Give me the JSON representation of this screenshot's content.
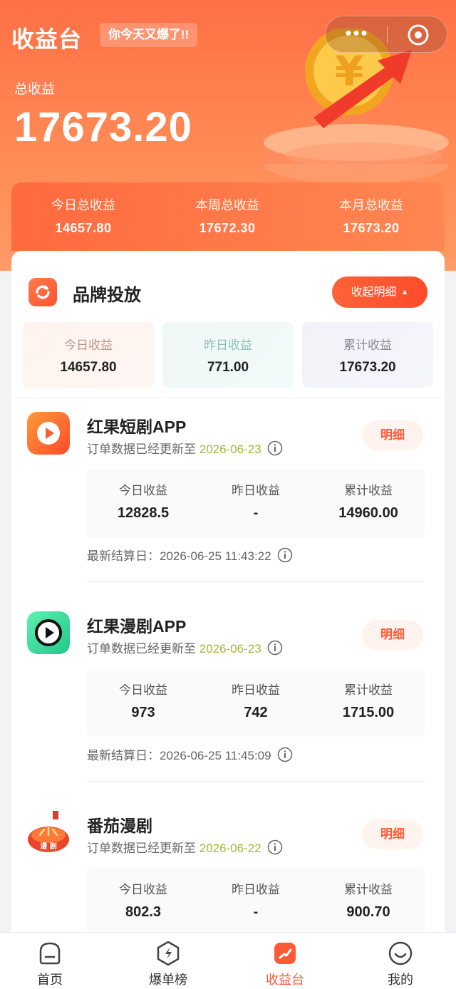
{
  "header": {
    "brand": "收益台",
    "tagline": "你今天又爆了!!",
    "total_label": "总收益",
    "total_value": "17673.20",
    "capsule": {
      "more_icon": "more-dots-icon",
      "close_icon": "target-circle-icon"
    }
  },
  "summary": [
    {
      "label": "今日总收益",
      "value": "14657.80"
    },
    {
      "label": "本周总收益",
      "value": "17672.30"
    },
    {
      "label": "本月总收益",
      "value": "17673.20"
    }
  ],
  "section": {
    "title": "品牌投放",
    "collapse_label": "收起明细",
    "stats": [
      {
        "label": "今日收益",
        "value": "14657.80",
        "label_color": "#c0958a"
      },
      {
        "label": "昨日收益",
        "value": "771.00",
        "label_color": "#8fbfb9"
      },
      {
        "label": "累计收益",
        "value": "17673.20",
        "label_color": "#8c8c99"
      }
    ]
  },
  "apps": [
    {
      "name": "红果短剧APP",
      "update_prefix": "订单数据已经更新至",
      "update_date": "2026-06-23",
      "detail_label": "明细",
      "stats": [
        {
          "label": "今日收益",
          "value": "12828.5"
        },
        {
          "label": "昨日收益",
          "value": "-"
        },
        {
          "label": "累计收益",
          "value": "14960.00"
        }
      ],
      "settle": "最新结算日：2026-06-25 11:43:22"
    },
    {
      "name": "红果漫剧APP",
      "update_prefix": "订单数据已经更新至",
      "update_date": "2026-06-23",
      "detail_label": "明细",
      "stats": [
        {
          "label": "今日收益",
          "value": "973"
        },
        {
          "label": "昨日收益",
          "value": "742"
        },
        {
          "label": "累计收益",
          "value": "1715.00"
        }
      ],
      "settle": "最新结算日：2026-06-25 11:45:09"
    },
    {
      "name": "番茄漫剧",
      "update_prefix": "订单数据已经更新至",
      "update_date": "2026-06-22",
      "detail_label": "明细",
      "stats": [
        {
          "label": "今日收益",
          "value": "802.3"
        },
        {
          "label": "昨日收益",
          "value": "-"
        },
        {
          "label": "累计收益",
          "value": "900.70"
        }
      ],
      "settle": ""
    }
  ],
  "tabs": [
    {
      "label": "首页",
      "icon": "home-icon",
      "active": false
    },
    {
      "label": "爆单榜",
      "icon": "lightning-icon",
      "active": false
    },
    {
      "label": "收益台",
      "icon": "earnings-icon",
      "active": true
    },
    {
      "label": "我的",
      "icon": "profile-face-icon",
      "active": false
    }
  ],
  "colors": {
    "accent": "#ff5a36",
    "date_green": "#a2b63a"
  }
}
